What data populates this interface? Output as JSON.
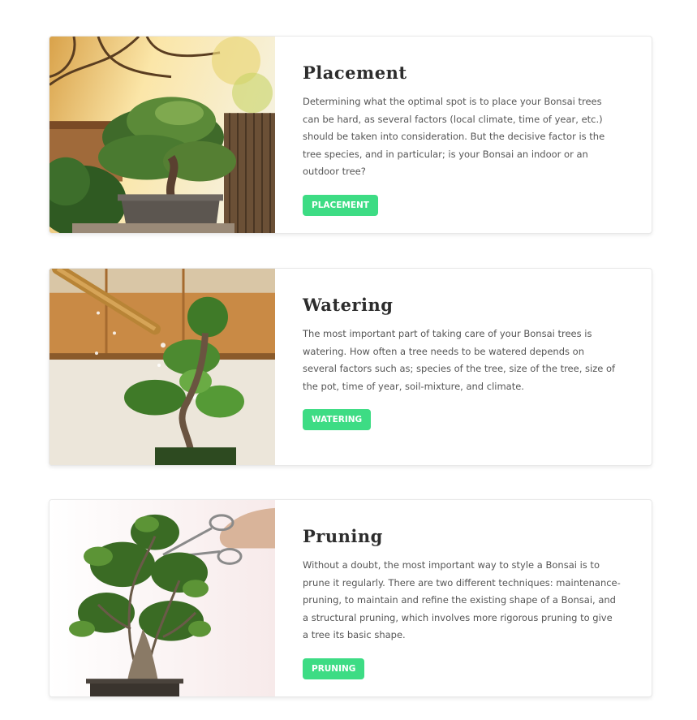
{
  "cards": [
    {
      "title": "Placement",
      "text": "Determining what the optimal spot is to place your Bonsai trees can be hard, as several factors (local climate, time of year, etc.) should be taken into consideration. But the decisive factor is the tree species, and in particular; is your Bonsai an indoor or an outdoor tree?",
      "button_label": "PLACEMENT"
    },
    {
      "title": "Watering",
      "text": "The most important part of taking care of your Bonsai trees is watering. How often a tree needs to be watered depends on several factors such as; species of the tree, size of the tree, size of the pot, time of year, soil-mixture, and climate.",
      "button_label": "WATERING"
    },
    {
      "title": "Pruning",
      "text": "Without a doubt, the most important way to style a Bonsai is to prune it regularly. There are two different techniques: maintenance-pruning, to maintain and refine the existing shape of a Bonsai, and a structural pruning, which involves more rigorous pruning to give a tree its basic shape.",
      "button_label": "PRUNING"
    }
  ],
  "colors": {
    "accent": "#3ddc84",
    "title": "#2d2d2d",
    "body": "#555555"
  }
}
